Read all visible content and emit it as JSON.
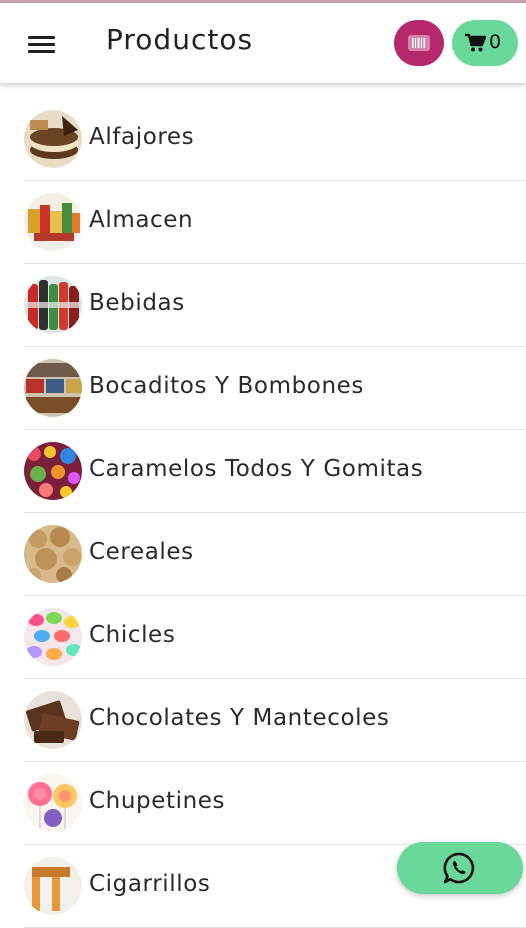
{
  "header": {
    "title": "Productos",
    "menu_icon": "hamburger-menu-icon",
    "barcode_icon": "barcode-icon",
    "cart_icon": "cart-icon",
    "cart_count": "0"
  },
  "colors": {
    "barcode_button": "#b5286b",
    "cart_button": "#69d89a",
    "whatsapp_button": "#69d89a"
  },
  "categories": [
    {
      "label": "Alfajores"
    },
    {
      "label": "Almacen"
    },
    {
      "label": "Bebidas"
    },
    {
      "label": "Bocaditos Y Bombones"
    },
    {
      "label": "Caramelos Todos Y Gomitas"
    },
    {
      "label": "Cereales"
    },
    {
      "label": "Chicles"
    },
    {
      "label": "Chocolates Y Mantecoles"
    },
    {
      "label": "Chupetines"
    },
    {
      "label": "Cigarrillos"
    }
  ],
  "fab": {
    "icon": "whatsapp-icon"
  }
}
